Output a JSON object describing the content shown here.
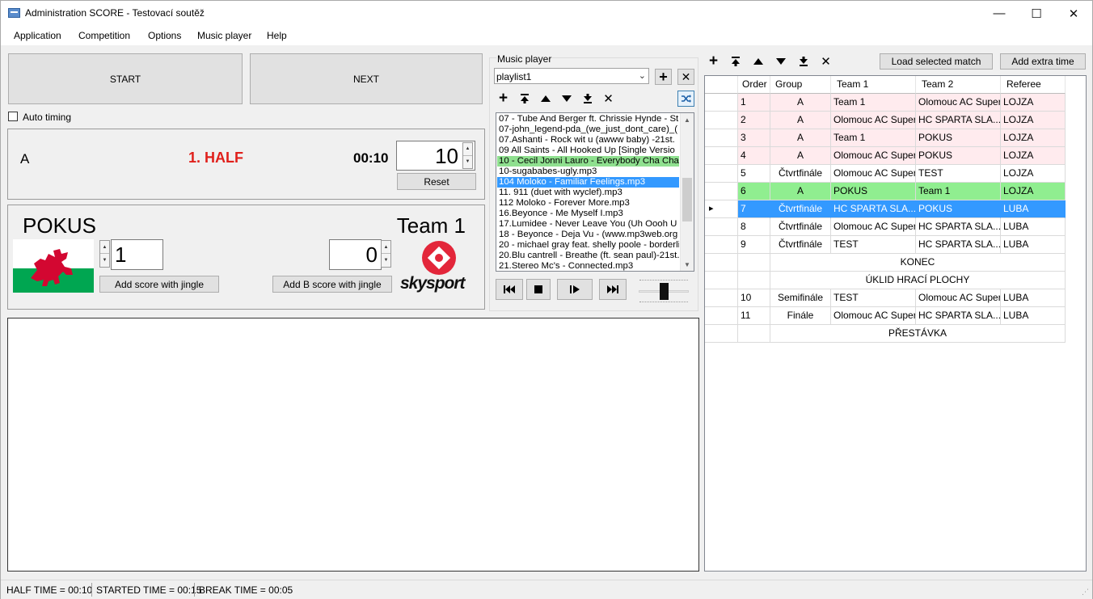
{
  "window": {
    "title": "Administration SCORE - Testovací soutěž",
    "minimize": "—",
    "maximize": "☐",
    "close": "✕"
  },
  "menu": [
    "Application",
    "Competition",
    "Options",
    "Music player",
    "Help"
  ],
  "controls": {
    "start": "START",
    "next": "NEXT",
    "auto_timing": "Auto timing"
  },
  "timer": {
    "group": "A",
    "period": "1. HALF",
    "clock": "00:10",
    "minutes": "10",
    "reset": "Reset"
  },
  "match": {
    "team_a": "POKUS",
    "score_a": "1",
    "add_a": "Add score with jingle",
    "team_b": "Team 1",
    "score_b": "0",
    "add_b": "Add B score with jingle",
    "logo_text": "skysport"
  },
  "music": {
    "label": "Music player",
    "playlist": "playlist1",
    "tracks": [
      "07 - Tube And Berger ft. Chrissie Hynde - St",
      "07-john_legend-pda_(we_just_dont_care)_(",
      "07.Ashanti - Rock wit u (awww baby) -21st.",
      "09  All Saints - All Hooked Up [Single Versio",
      "10 - Cecil Jonni Lauro - Everybody Cha Cha",
      "10-sugababes-ugly.mp3",
      "104  Moloko - Familiar Feelings.mp3",
      "11. 911 (duet with wyclef).mp3",
      "112  Moloko - Forever More.mp3",
      "16.Beyonce - Me Myself I.mp3",
      "17.Lumidee - Never Leave You (Uh Oooh U",
      "18 - Beyonce - Deja Vu - (www.mp3web.org",
      "20 - michael gray feat. shelly poole - borderli",
      "20.Blu cantrell - Breathe (ft. sean paul)-21st.",
      "21.Stereo Mc's - Connected.mp3"
    ],
    "playing_index": 4,
    "selected_index": 6,
    "volume_fraction": 0.5
  },
  "schedule": {
    "load_selected": "Load selected match",
    "add_extra": "Add extra time",
    "headers": [
      "Order",
      "Group",
      "Team 1",
      "Team 2",
      "Referee"
    ],
    "rows": [
      {
        "order": "1",
        "group": "A",
        "team1": "Team 1",
        "team2": "Olomouc AC Super",
        "referee": "LOJZA",
        "style": "pink"
      },
      {
        "order": "2",
        "group": "A",
        "team1": "Olomouc AC Super",
        "team2": "HC SPARTA SLA...",
        "referee": "LOJZA",
        "style": "pink"
      },
      {
        "order": "3",
        "group": "A",
        "team1": "Team 1",
        "team2": "POKUS",
        "referee": "LOJZA",
        "style": "pink"
      },
      {
        "order": "4",
        "group": "A",
        "team1": "Olomouc AC Super",
        "team2": "POKUS",
        "referee": "LOJZA",
        "style": "pink"
      },
      {
        "order": "5",
        "group": "Čtvrtfinále",
        "team1": "Olomouc AC Super",
        "team2": "TEST",
        "referee": "LOJZA",
        "style": "normal"
      },
      {
        "order": "6",
        "group": "A",
        "team1": "POKUS",
        "team2": "Team 1",
        "referee": "LOJZA",
        "style": "green"
      },
      {
        "order": "7",
        "group": "Čtvrtfinále",
        "team1": "HC SPARTA SLA...",
        "team2": "POKUS",
        "referee": "LUBA",
        "style": "selected"
      },
      {
        "order": "8",
        "group": "Čtvrtfinále",
        "team1": "Olomouc AC Super",
        "team2": "HC SPARTA SLA...",
        "referee": "LUBA",
        "style": "normal"
      },
      {
        "order": "9",
        "group": "Čtvrtfinále",
        "team1": "TEST",
        "team2": "HC SPARTA SLA...",
        "referee": "LUBA",
        "style": "normal"
      },
      {
        "label": "KONEC"
      },
      {
        "label": "ÚKLID HRACÍ PLOCHY"
      },
      {
        "order": "10",
        "group": "Semifinále",
        "team1": "TEST",
        "team2": "Olomouc AC Super",
        "referee": "LUBA",
        "style": "normal"
      },
      {
        "order": "11",
        "group": "Finále",
        "team1": "Olomouc AC Super",
        "team2": "HC SPARTA SLA...",
        "referee": "LUBA",
        "style": "normal"
      },
      {
        "label": "PŘESTÁVKA"
      }
    ]
  },
  "status": {
    "half_time": "HALF TIME = 00:10",
    "started_time": "STARTED TIME = 00:15",
    "break_time": "BREAK TIME = 00:05"
  },
  "colors": {
    "period": "#e0201b",
    "playing": "#8fe08f",
    "selected": "#3399ff",
    "pink_row": "#ffebee",
    "green_row": "#90ee90",
    "logo_red": "#e3263a"
  }
}
